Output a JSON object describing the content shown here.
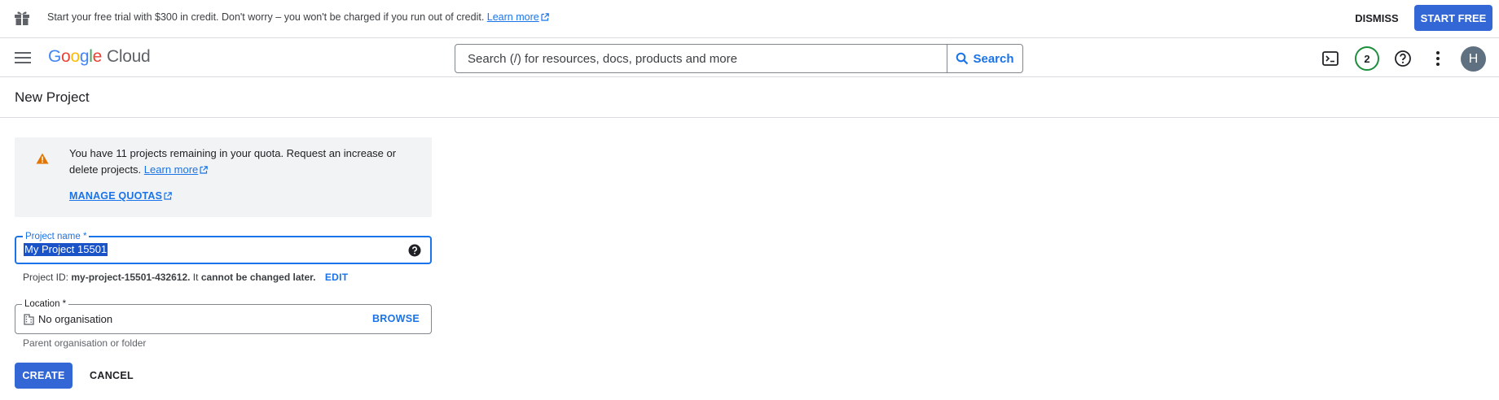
{
  "banner": {
    "message": "Start your free trial with $300 in credit. Don't worry – you won't be charged if you run out of credit.",
    "learn_more": "Learn more",
    "dismiss_label": "DISMISS",
    "start_free_label": "START FREE",
    "icon": "gift-icon"
  },
  "header": {
    "menu_icon": "hamburger-menu-icon",
    "logo": {
      "g1": "G",
      "g2": "o",
      "g3": "o",
      "g4": "g",
      "g5": "l",
      "g6": "e",
      "product": "Cloud"
    },
    "search": {
      "placeholder": "Search (/) for resources, docs, products and more",
      "button_label": "Search"
    },
    "notification_count": "2",
    "avatar_initial": "H",
    "icons": [
      "cloud-shell-icon",
      "help-icon",
      "more-vert-icon"
    ]
  },
  "page": {
    "title": "New Project"
  },
  "quota_notice": {
    "text": "You have 11 projects remaining in your quota. Request an increase or delete projects.",
    "learn_more": "Learn more",
    "manage_quotas": "MANAGE QUOTAS",
    "icon": "warning-icon"
  },
  "form": {
    "project_name": {
      "label": "Project name *",
      "value": "My Project 15501"
    },
    "project_id": {
      "prefix": "Project ID:",
      "value": "my-project-15501-432612.",
      "middle": "It",
      "warning": "cannot be changed later.",
      "edit_label": "EDIT"
    },
    "location": {
      "label": "Location *",
      "value": "No organisation",
      "browse_label": "BROWSE",
      "hint": "Parent organisation or folder"
    },
    "create_label": "CREATE",
    "cancel_label": "CANCEL"
  },
  "colors": {
    "primary_blue": "#1a73e8",
    "button_blue": "#3367d6",
    "warning_orange": "#e37400",
    "badge_green": "#1e8e3e"
  }
}
